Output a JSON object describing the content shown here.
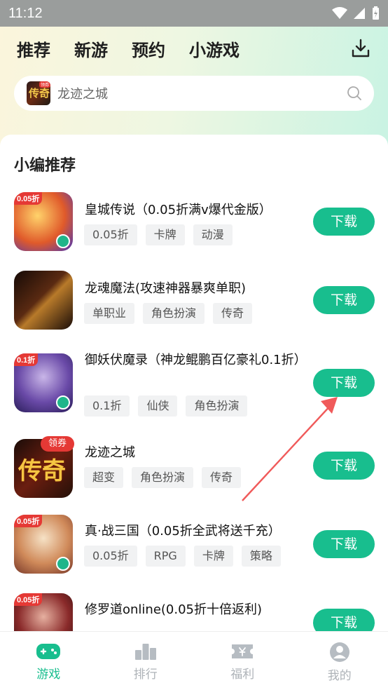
{
  "status_bar": {
    "time": "11:12"
  },
  "tabs": [
    {
      "label": "推荐",
      "active": true
    },
    {
      "label": "新游",
      "active": false
    },
    {
      "label": "预约",
      "active": false
    },
    {
      "label": "小游戏",
      "active": false
    }
  ],
  "search": {
    "text": "龙迹之城",
    "thumb_text": "传奇",
    "thumb_badge": "领券"
  },
  "section": {
    "title": "小编推荐"
  },
  "games": [
    {
      "title": "皇城传说（0.05折满v爆代金版）",
      "tags": [
        "0.05折",
        "卡牌",
        "动漫"
      ],
      "icon_tag": "0.05折",
      "button": "下载"
    },
    {
      "title": "龙魂魔法(攻速神器暴爽单职)",
      "tags": [
        "单职业",
        "角色扮演",
        "传奇"
      ],
      "icon_tag": "",
      "button": "下载"
    },
    {
      "title": "御妖伏魔录（神龙鲲鹏百亿豪礼0.1折）",
      "tags": [
        "0.1折",
        "仙侠",
        "角色扮演"
      ],
      "icon_tag": "0.1折",
      "button": "下载"
    },
    {
      "title": "龙迹之城",
      "tags": [
        "超变",
        "角色扮演",
        "传奇"
      ],
      "icon_tag": "",
      "icon_text": "传奇",
      "badge": "领券",
      "button": "下载"
    },
    {
      "title": "真·战三国（0.05折全武将送千充）",
      "tags": [
        "0.05折",
        "RPG",
        "卡牌",
        "策略"
      ],
      "icon_tag": "0.05折",
      "button": "下载"
    },
    {
      "title": "修罗道online(0.05折十倍返利)",
      "tags": [],
      "icon_tag": "0.05折",
      "button": "下载"
    }
  ],
  "bottom_nav": [
    {
      "label": "游戏",
      "icon": "gamepad-icon",
      "active": true
    },
    {
      "label": "排行",
      "icon": "bar-chart-icon",
      "active": false
    },
    {
      "label": "福利",
      "icon": "ticket-icon",
      "active": false
    },
    {
      "label": "我的",
      "icon": "user-icon",
      "active": false
    }
  ],
  "colors": {
    "accent": "#18be8e",
    "tab_highlight": "#5ee3c4",
    "annotation_arrow": "#f05a5a"
  }
}
